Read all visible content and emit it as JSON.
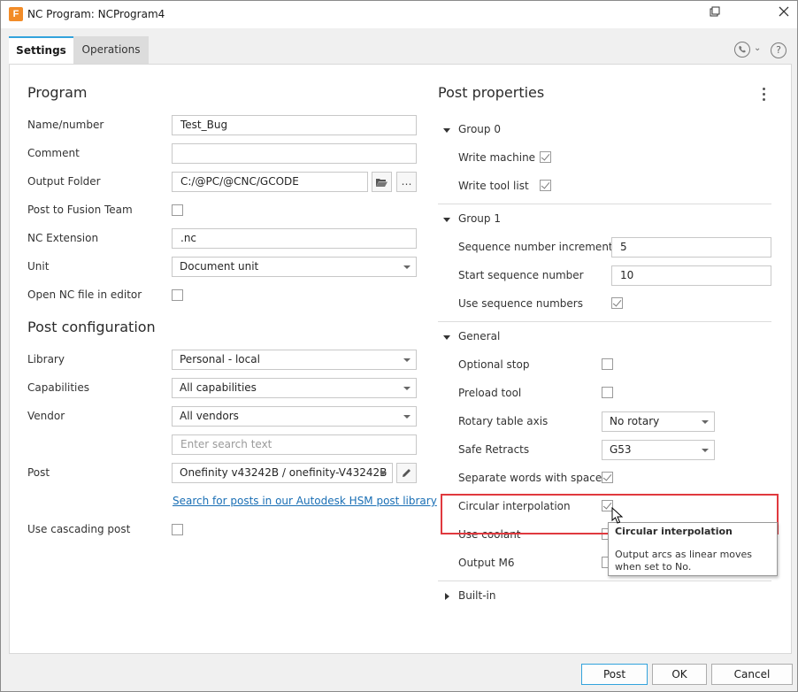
{
  "window": {
    "title": "NC Program: NCProgram4",
    "app_icon_letter": "F",
    "restore_icon": "restore-window-icon",
    "close_icon": "close-icon"
  },
  "tabs": [
    {
      "label": "Settings",
      "active": true
    },
    {
      "label": "Operations",
      "active": false
    }
  ],
  "program": {
    "heading": "Program",
    "name_label": "Name/number",
    "name_value": "Test_Bug",
    "comment_label": "Comment",
    "comment_value": "",
    "output_folder_label": "Output Folder",
    "output_folder_value": "C:/@PC/@CNC/GCODE",
    "browse_button_glyph": "…",
    "post_to_team_label": "Post to Fusion Team",
    "nc_extension_label": "NC Extension",
    "nc_extension_value": ".nc",
    "unit_label": "Unit",
    "unit_value": "Document unit",
    "open_nc_label": "Open NC file in editor"
  },
  "post_config": {
    "heading": "Post configuration",
    "library_label": "Library",
    "library_value": "Personal - local",
    "capabilities_label": "Capabilities",
    "capabilities_value": "All capabilities",
    "vendor_label": "Vendor",
    "vendor_value": "All vendors",
    "search_placeholder": "Enter search text",
    "post_label": "Post",
    "post_value": "Onefinity v43242B / onefinity-V43242B",
    "search_link": "Search for posts in our Autodesk HSM post library",
    "cascading_label": "Use cascading post"
  },
  "post_properties": {
    "heading": "Post properties",
    "group0": {
      "label": "Group 0",
      "write_machine_label": "Write machine",
      "write_machine_checked": true,
      "write_tool_list_label": "Write tool list",
      "write_tool_list_checked": true
    },
    "group1": {
      "label": "Group 1",
      "seq_increment_label": "Sequence number increment",
      "seq_increment_value": "5",
      "start_seq_label": "Start sequence number",
      "start_seq_value": "10",
      "use_seq_label": "Use sequence numbers",
      "use_seq_checked": true
    },
    "general": {
      "label": "General",
      "optional_stop_label": "Optional stop",
      "preload_tool_label": "Preload tool",
      "rotary_axis_label": "Rotary table axis",
      "rotary_axis_value": "No rotary",
      "safe_retracts_label": "Safe Retracts",
      "safe_retracts_value": "G53",
      "separate_words_label": "Separate words with space",
      "separate_words_checked": true,
      "circular_interp_label": "Circular interpolation",
      "circular_interp_checked": true,
      "use_coolant_label": "Use coolant",
      "output_m6_label": "Output M6"
    },
    "builtin": {
      "label": "Built-in"
    }
  },
  "tooltip": {
    "title": "Circular interpolation",
    "body": "Output arcs as linear moves when set to No."
  },
  "footer": {
    "post_label": "Post",
    "ok_label": "OK",
    "cancel_label": "Cancel"
  },
  "colors": {
    "accent": "#33a3dc",
    "highlight_border": "#e0393e",
    "link": "#1a6fb5",
    "app_icon": "#f28c28"
  }
}
